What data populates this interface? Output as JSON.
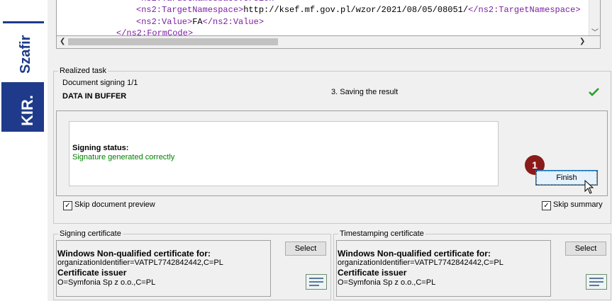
{
  "brand": {
    "name": "Szafir",
    "company": "KIR."
  },
  "xml": {
    "line1": {
      "open": "<ns2:TargetNamespace>",
      "value": "http://ksef.mf.gov.pl/wzor/2021/08/05/08051/",
      "close": "</ns2:TargetNamespace>"
    },
    "line2": {
      "open": "<ns2:Value>",
      "value": "FA",
      "close": "</ns2:Value>"
    },
    "line3": {
      "close": "</ns2:FormCode>"
    }
  },
  "task": {
    "legend": "Realized task",
    "document_signing": "Document signing 1/1",
    "buffer_status": "DATA IN BUFFER",
    "step": "3. Saving the result",
    "signing_status_label": "Signing status:",
    "signing_status_value": "Signature generated correctly",
    "finish_label": "Finish",
    "badge": "1"
  },
  "options": {
    "skip_preview": "Skip document preview",
    "skip_summary": "Skip summary",
    "check_mark": "✓"
  },
  "signing_cert": {
    "legend": "Signing certificate",
    "select": "Select",
    "title": "Windows Non-qualified certificate for:",
    "subject": "organizationIdentifier=VATPL7742842442,C=PL",
    "issuer_label": "Certificate issuer",
    "issuer": "O=Symfonia Sp z o.o.,C=PL"
  },
  "ts_cert": {
    "legend": "Timestamping certificate",
    "select": "Select",
    "title": "Windows Non-qualified certificate for:",
    "subject": "organizationIdentifier=VATPL7742842442,C=PL",
    "issuer_label": "Certificate issuer",
    "issuer": "O=Symfonia Sp z o.o.,C=PL"
  },
  "colors": {
    "accent": "#1f3a8a",
    "success": "#008000",
    "badge": "#8b1a1a"
  }
}
